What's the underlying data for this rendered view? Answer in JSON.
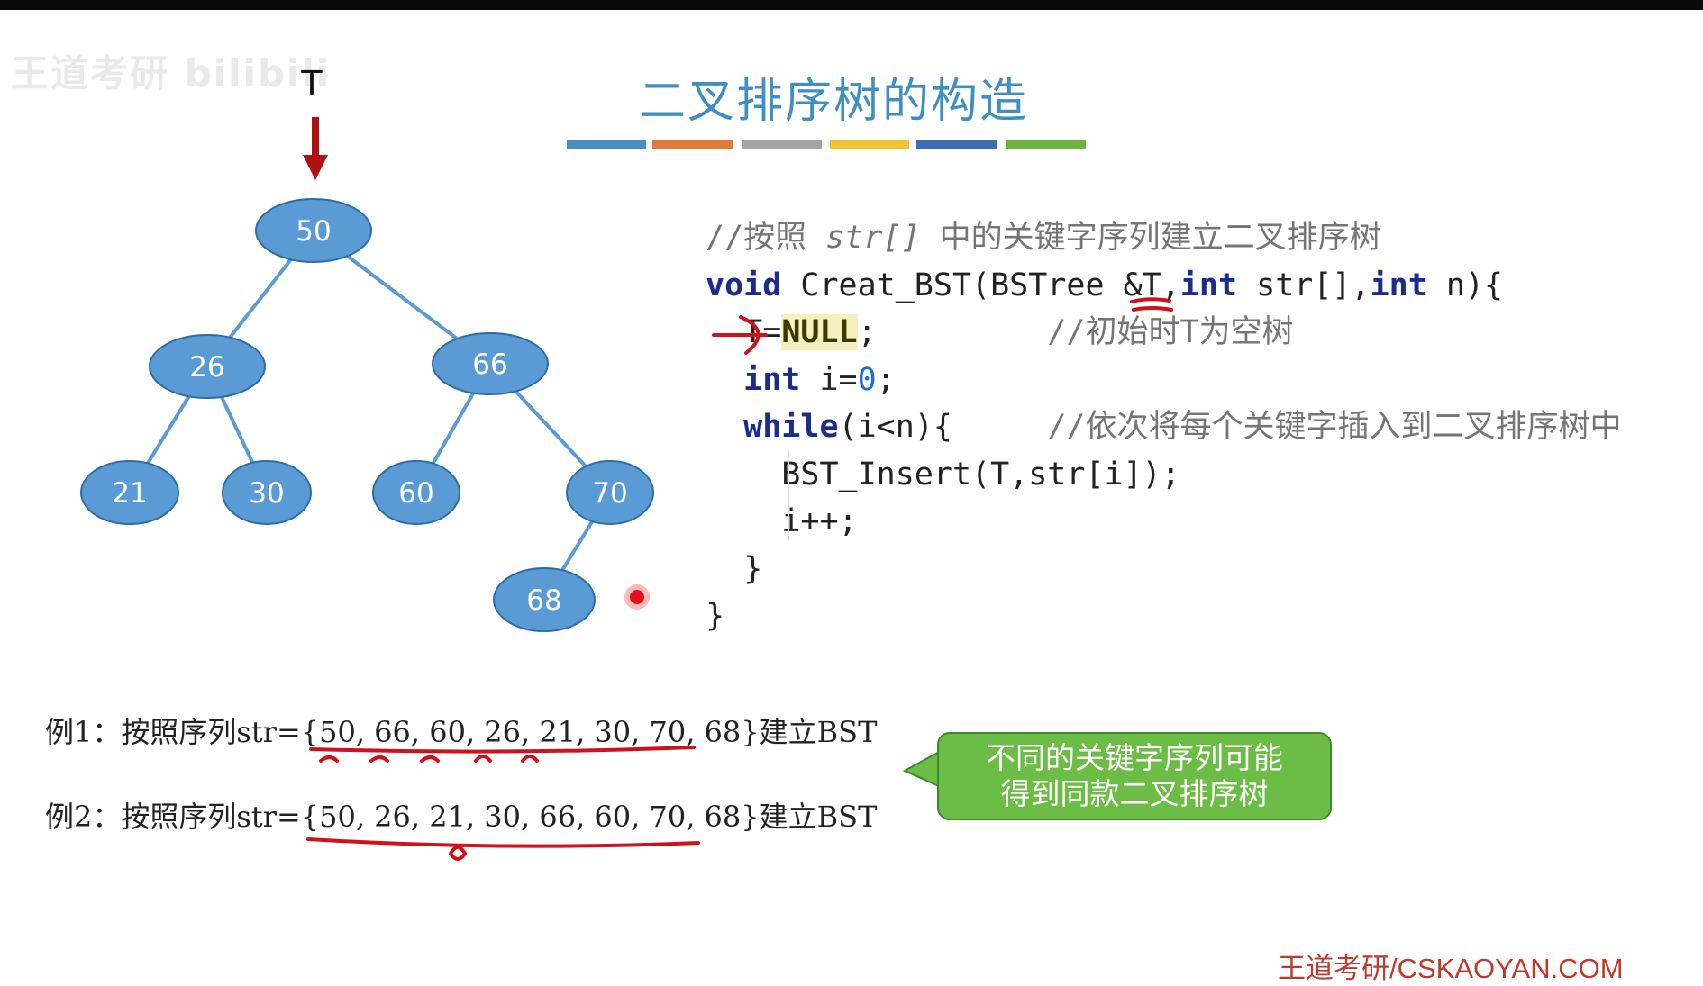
{
  "watermark": "王道考研 bilibili",
  "title": "二叉排序树的构造",
  "color_bar": [
    "#4a8fc4",
    "#e07b39",
    "#a5a5a5",
    "#f1c232",
    "#3d6db5",
    "#6cb33e"
  ],
  "pointer_label": "T",
  "tree": {
    "nodes": [
      {
        "id": "n50",
        "label": "50"
      },
      {
        "id": "n26",
        "label": "26"
      },
      {
        "id": "n66",
        "label": "66"
      },
      {
        "id": "n21",
        "label": "21"
      },
      {
        "id": "n30",
        "label": "30"
      },
      {
        "id": "n60",
        "label": "60"
      },
      {
        "id": "n70",
        "label": "70"
      },
      {
        "id": "n68",
        "label": "68"
      }
    ],
    "edges": [
      [
        "n50",
        "n26"
      ],
      [
        "n50",
        "n66"
      ],
      [
        "n26",
        "n21"
      ],
      [
        "n26",
        "n30"
      ],
      [
        "n66",
        "n60"
      ],
      [
        "n66",
        "n70"
      ],
      [
        "n70",
        "n68"
      ]
    ],
    "node_fill": "#5b9bd5",
    "node_stroke": "#2e6da4",
    "edge_color": "#5b9bd5"
  },
  "code": {
    "comment1": "//按照 ",
    "comment1_var": "str[]",
    "comment1_rest": " 中的关键字序列建立二叉排序树",
    "l2_kw": "void",
    "l2_fn": " Creat_BST(",
    "l2_type": "BSTree",
    "l2_arg1": " &T,",
    "l2_kw2": "int",
    "l2_arg2": " str[],",
    "l2_kw3": "int",
    "l2_arg3": " n){",
    "l3_code": "T=",
    "l3_null": "NULL",
    "l3_semi": ";",
    "l3_comment": "//初始时T为空树",
    "l4_kw": "int",
    "l4_code": " i=",
    "l4_num": "0",
    "l4_semi": ";",
    "l5_kw": "while",
    "l5_code": "(i<n){",
    "l5_comment": "//依次将每个关键字插入到二叉排序树中",
    "l6": "BST_Insert(T,str[i]);",
    "l7": "i++;",
    "l8": "}",
    "l9": "}"
  },
  "examples": [
    "例1：按照序列str={50, 66, 60, 26, 21, 30, 70, 68}建立BST",
    "例2：按照序列str={50, 26, 21, 30, 66, 60, 70, 68}建立BST"
  ],
  "callout": {
    "line1": "不同的关键字序列可能",
    "line2": "得到同款二叉排序树",
    "fill": "#6cbd45"
  },
  "footer": "王道考研/CSKAOYAN.COM",
  "annotation_color": "#d0101a"
}
